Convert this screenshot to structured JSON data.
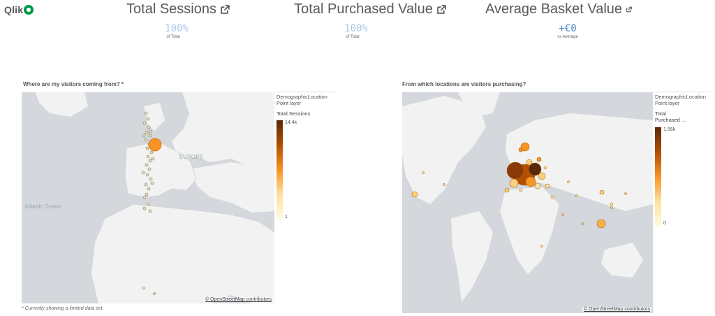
{
  "logo": {
    "text": "Qlik"
  },
  "kpis": [
    {
      "title": "Total Sessions",
      "value": "100%",
      "sub": "of Total"
    },
    {
      "title": "Total Purchased Value",
      "value": "100%",
      "sub": "of Total"
    },
    {
      "title": "Average Basket Value",
      "value": "+€0",
      "sub": "vs Average"
    }
  ],
  "left_chart": {
    "title": "Where are my visitors coming from? *",
    "legend_layer": "DemographicLocation",
    "legend_layer_type": "Point layer",
    "legend_measure": "Total Sessions",
    "legend_max": "14.4k",
    "legend_min": "1",
    "map_labels": {
      "europe": "EUROPE",
      "ocean": "Atlantic Ocean"
    },
    "attribution": "© OpenStreetMap contributors"
  },
  "right_chart": {
    "title": "From which locations are visitors purchasing?",
    "legend_layer": "DemographicLocation",
    "legend_layer_type": "Point layer",
    "legend_measure": "Total Purchased ...",
    "legend_max": "1.56k",
    "legend_min": "0",
    "attribution": "© OpenStreetMap contributors"
  },
  "footnote": "* Currently showing a limited data set.",
  "colors": {
    "land": "#f2f2f2",
    "water": "#d4d7dc",
    "kpi_value": "#a7c7e7",
    "accent_dark": "#5a2708",
    "accent_orange": "#f79425"
  }
}
